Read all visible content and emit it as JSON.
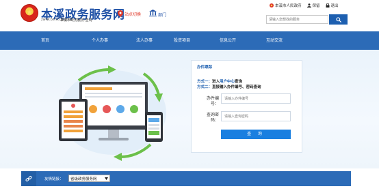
{
  "header": {
    "site_title": "本溪政务服务网",
    "site_domain": "zwfw.benxi.gov.cn",
    "site_subtitle": "本溪市政务服务·查询",
    "location_label": "站点切换",
    "dept_label": "部门",
    "top_links": [
      {
        "label": "本溪市人民政府",
        "icon": "gov-icon"
      },
      {
        "label": "保留",
        "icon": "user-icon"
      },
      {
        "label": "退出",
        "icon": "lock-icon"
      }
    ],
    "search_placeholder": "请输入您想找的服务"
  },
  "nav": {
    "items": [
      "首页",
      "个人办事",
      "法人办事",
      "投资项目",
      "信息公开",
      "互动交流"
    ]
  },
  "panel": {
    "title": "办件跟踪",
    "method1_label": "方式一：",
    "method1_text_a": "进入",
    "method1_highlight": "用户中心",
    "method1_text_b": "查询",
    "method2_label": "方式二：",
    "method2_text": "直接输入办件编号、密码查询",
    "field1_label": "办件编号：",
    "field1_placeholder": "请输入办件编号",
    "field2_label": "查询密码：",
    "field2_placeholder": "请输入查询密码",
    "query_button": "查 询"
  },
  "footer": {
    "friend_label": "友情链接：",
    "friend_select": "省级政务服务网"
  },
  "colors": {
    "brand_blue": "#2c6bb7",
    "accent_red": "#e03a2a",
    "button_blue": "#1a7fe0"
  }
}
